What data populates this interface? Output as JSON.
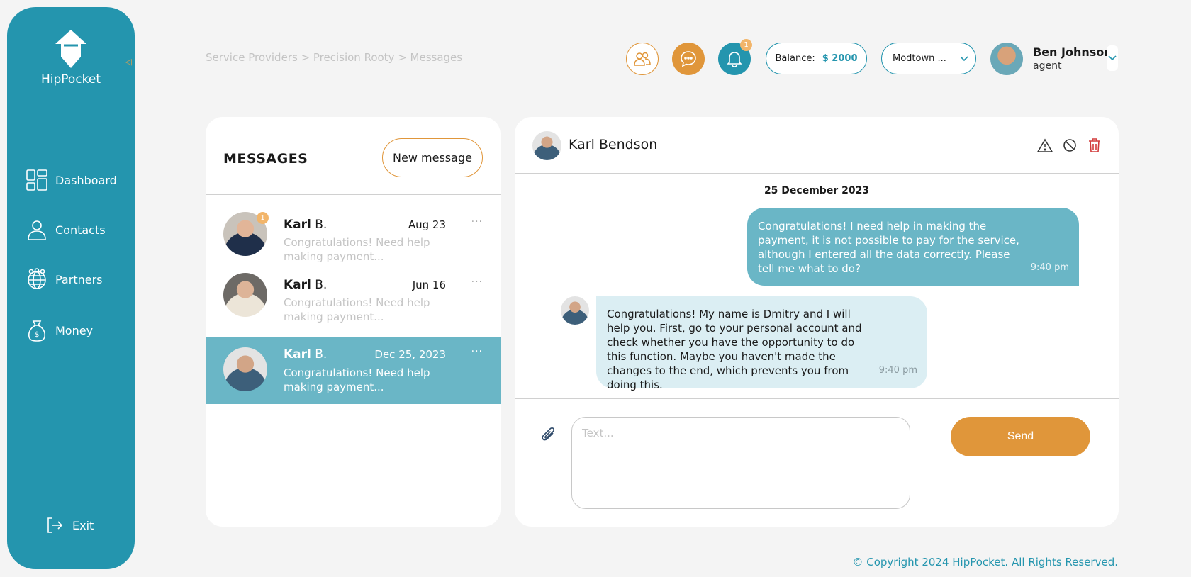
{
  "app": {
    "name": "HipPocket"
  },
  "sidebar": {
    "items": [
      {
        "label": "Dashboard",
        "icon": "dashboard-icon"
      },
      {
        "label": "Contacts",
        "icon": "contacts-icon"
      },
      {
        "label": "Partners",
        "icon": "partners-icon"
      },
      {
        "label": "Money",
        "icon": "money-bag-icon"
      }
    ],
    "exit_label": "Exit"
  },
  "header": {
    "breadcrumb": "Service Providers > Precision Rooty > Messages",
    "notification_count": "1",
    "balance_label": "Balance:",
    "balance_value": "$ 2000",
    "location": "Modtown ...",
    "user": {
      "name": "Ben Johnson",
      "role": "agent"
    }
  },
  "messages": {
    "title": "MESSAGES",
    "new_message_label": "New message",
    "conversations": [
      {
        "first": "Karl",
        "last": " B.",
        "date": "Aug 23",
        "preview": "Congratulations! Need help making payment...",
        "badge": "1",
        "more": "···"
      },
      {
        "first": "Karl",
        "last": " B.",
        "date": "Jun 16",
        "preview": "Congratulations! Need help making payment...",
        "badge": "",
        "more": "···"
      },
      {
        "first": "Karl",
        "last": " B.",
        "date": "Dec 25, 2023",
        "preview": "Congratulations! Need help making payment...",
        "badge": "",
        "more": "···"
      }
    ]
  },
  "chat": {
    "contact_name": "Karl Bendson",
    "date": "25 December 2023",
    "outgoing": {
      "text": "Congratulations! I need help in making the payment, it is not possible to pay for the service, although I entered all the data correctly. Please tell me what to do?",
      "time": "9:40 pm"
    },
    "incoming": {
      "text": "Congratulations! My name is Dmitry and I will help you. First, go to your personal account and check whether you have the opportunity to do this function. Maybe you haven't made the changes to the end, which prevents you from doing this.",
      "time": "9:40 pm"
    },
    "input_placeholder": "Text...",
    "send_label": "Send"
  },
  "footer": {
    "text": "© Copyright 2024 HipPocket. All Rights Reserved."
  },
  "colors": {
    "primary": "#2495ae",
    "accent": "#e0963a",
    "active_row": "#6ab6c6",
    "incoming_bubble": "#dbeef3"
  }
}
